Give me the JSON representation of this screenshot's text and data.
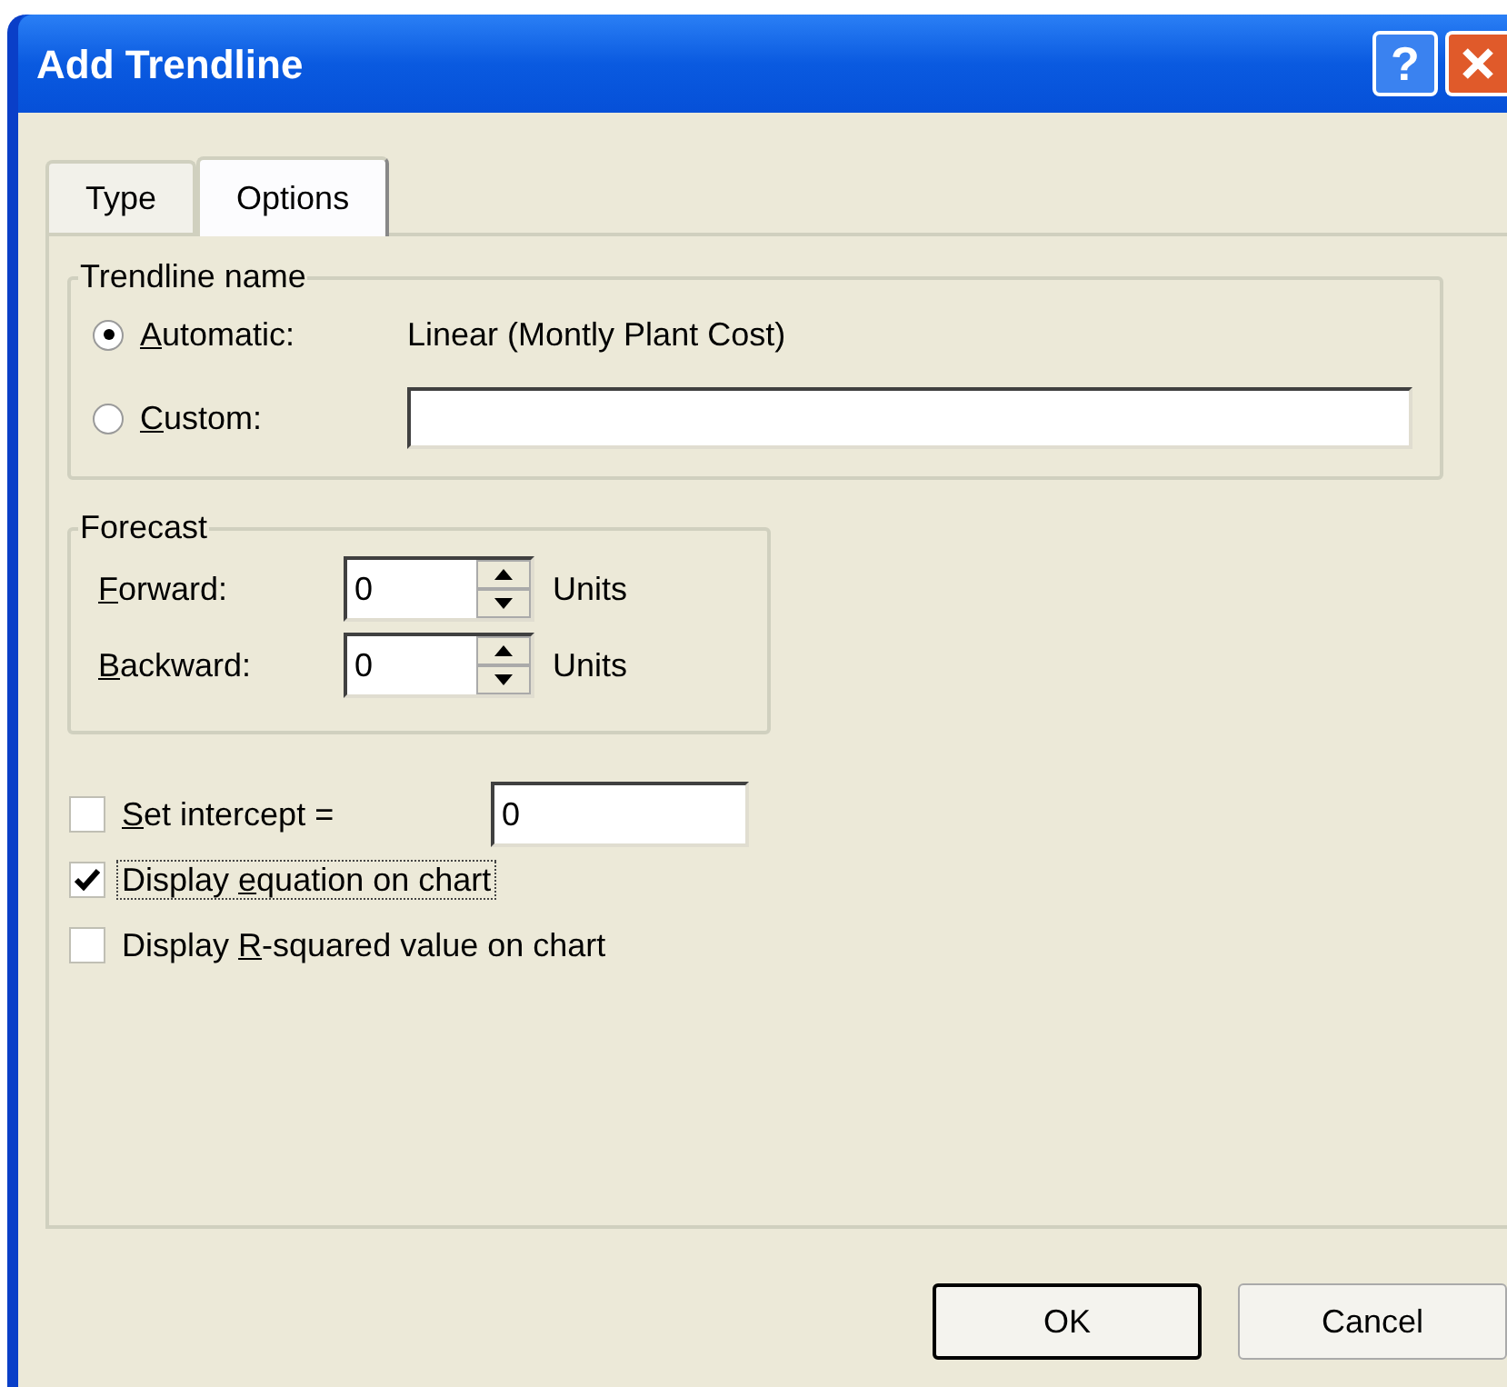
{
  "window": {
    "title": "Add Trendline"
  },
  "help_button": {
    "label": "?"
  },
  "tabs": [
    {
      "label": "Type",
      "selected": false
    },
    {
      "label": "Options",
      "selected": true
    }
  ],
  "trendline_name": {
    "legend": "Trendline name",
    "options": [
      {
        "kind": "text",
        "label": {
          "key": "A",
          "post": "utomatic:"
        },
        "selected": true,
        "value": "Linear (Montly Plant Cost)"
      },
      {
        "kind": "input",
        "label": {
          "key": "C",
          "post": "ustom:"
        },
        "selected": false
      }
    ]
  },
  "forecast": {
    "legend": "Forecast",
    "rows": [
      {
        "label": {
          "key": "F",
          "post": "orward:"
        },
        "value": "0",
        "unit": "Units"
      },
      {
        "label": {
          "key": "B",
          "post": "ackward:"
        },
        "value": "0",
        "unit": "Units"
      }
    ]
  },
  "checks": [
    {
      "kind": "input",
      "label": {
        "key": "S",
        "post": "et intercept ="
      },
      "checked": false,
      "focused": false,
      "value": "0"
    },
    {
      "kind": "plain",
      "label": {
        "pre": "Display ",
        "key": "e",
        "post": "quation on chart"
      },
      "checked": true,
      "focused": true
    },
    {
      "kind": "plain",
      "label": {
        "pre": "Display ",
        "key": "R",
        "post": "-squared value on chart"
      },
      "checked": false,
      "focused": false
    }
  ],
  "buttons": [
    {
      "label": "OK",
      "default": true
    },
    {
      "label": "Cancel",
      "default": false
    }
  ]
}
